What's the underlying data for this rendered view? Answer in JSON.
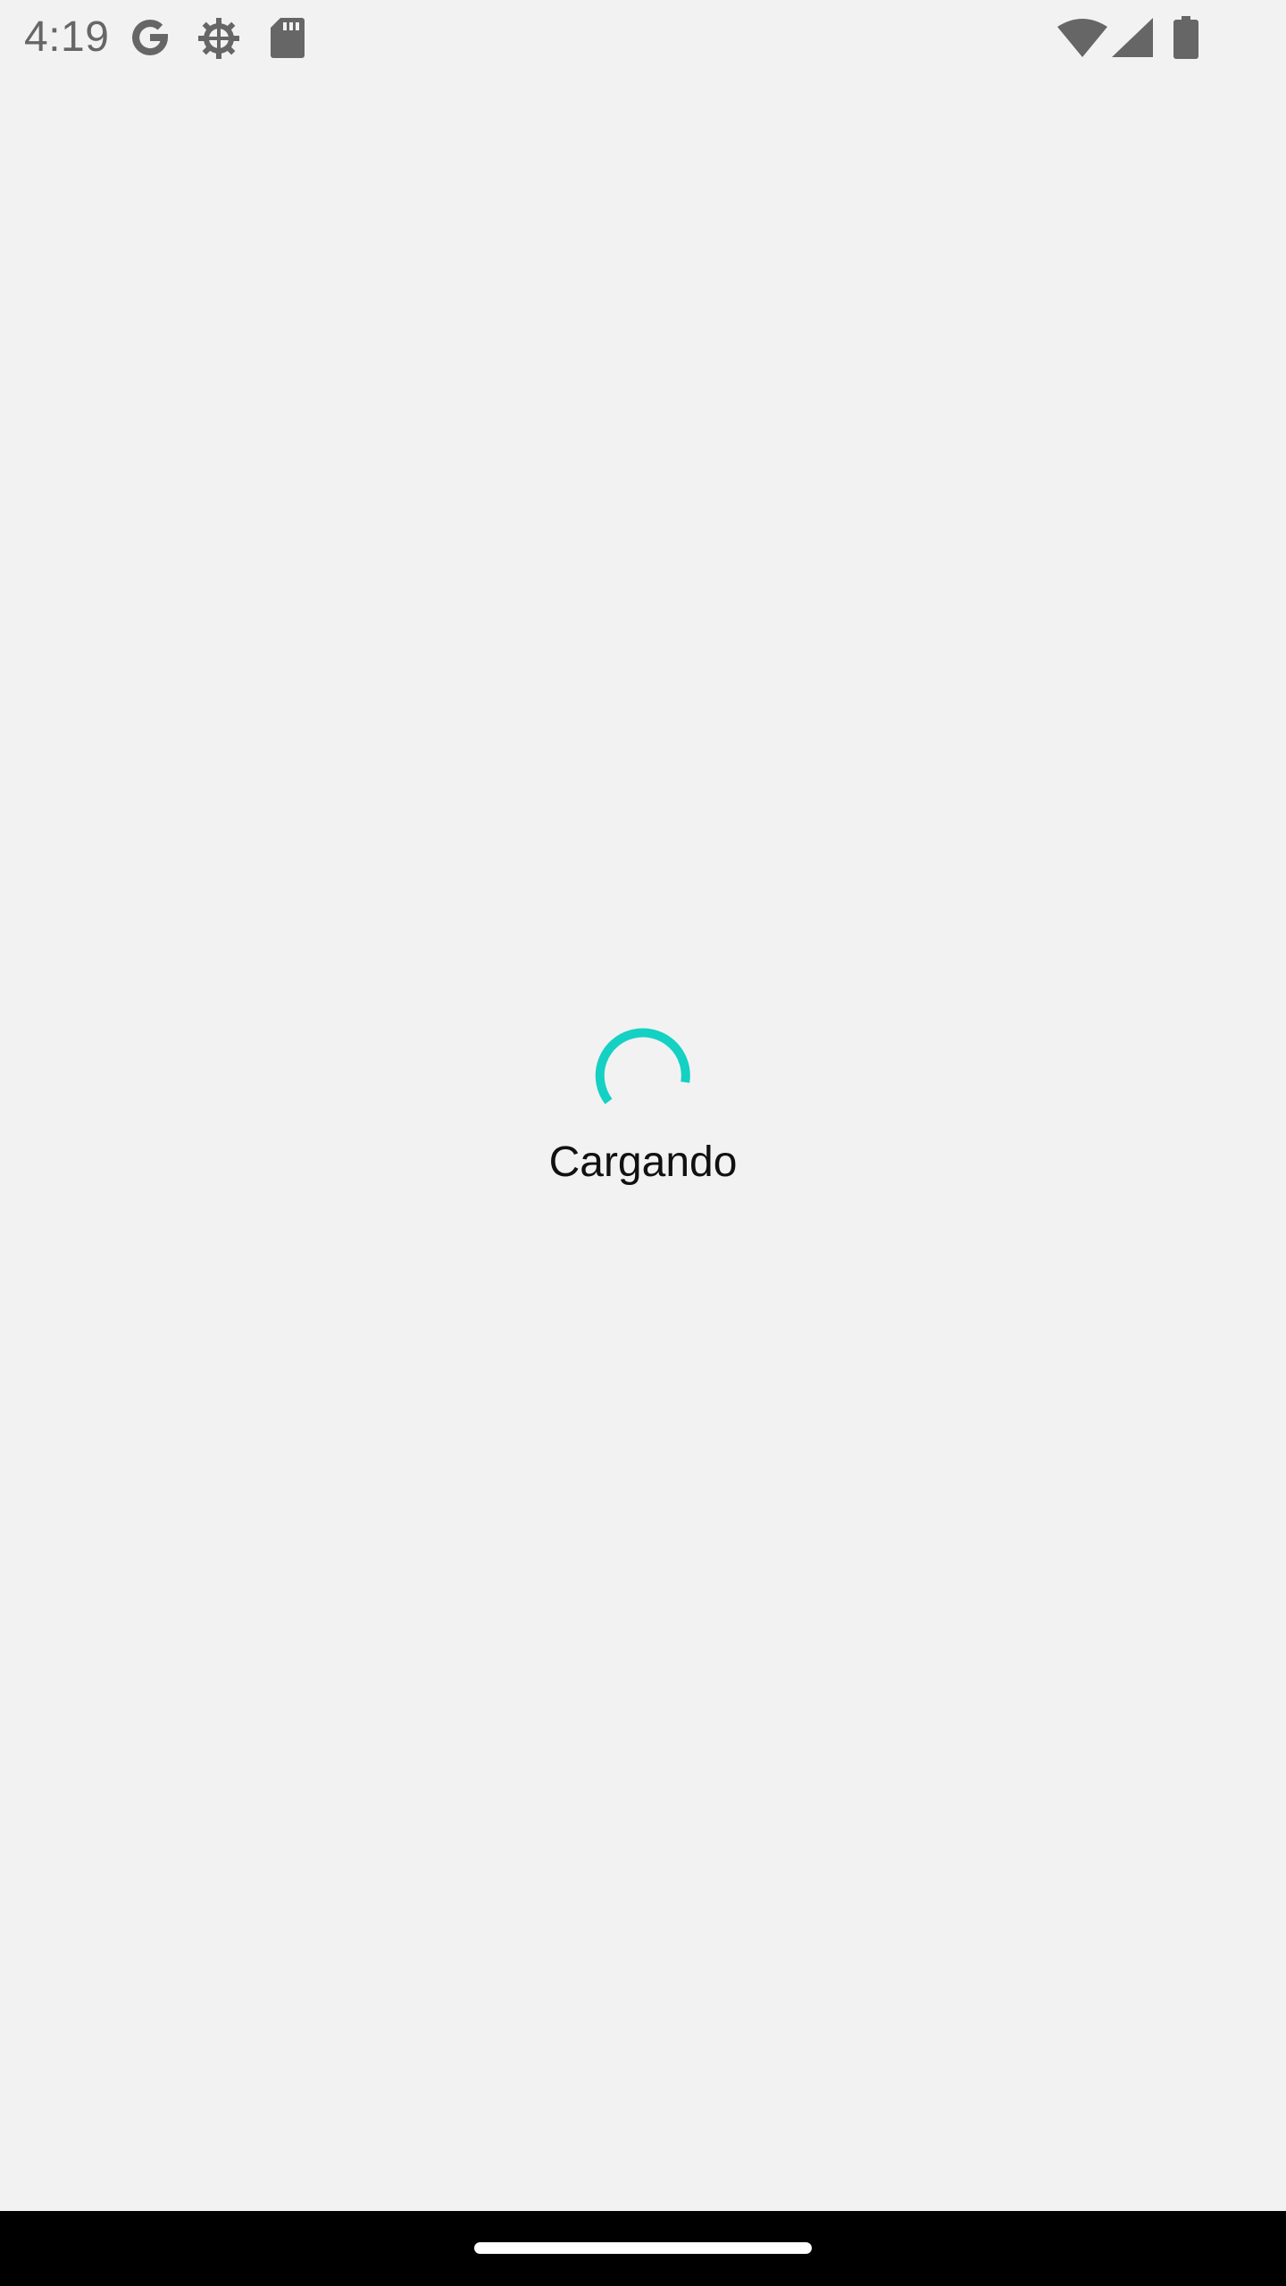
{
  "status_bar": {
    "time": "4:19",
    "icon_color": "#666666",
    "left_icons": [
      "google-icon",
      "settings-gear-icon",
      "sd-card-icon"
    ],
    "right_icons": [
      "wifi-icon",
      "cell-signal-icon",
      "battery-icon"
    ]
  },
  "loading": {
    "label": "Cargando",
    "spinner_color": "#14d1c3"
  },
  "nav_bar": {
    "background": "#000000",
    "handle_color": "#ffffff"
  }
}
